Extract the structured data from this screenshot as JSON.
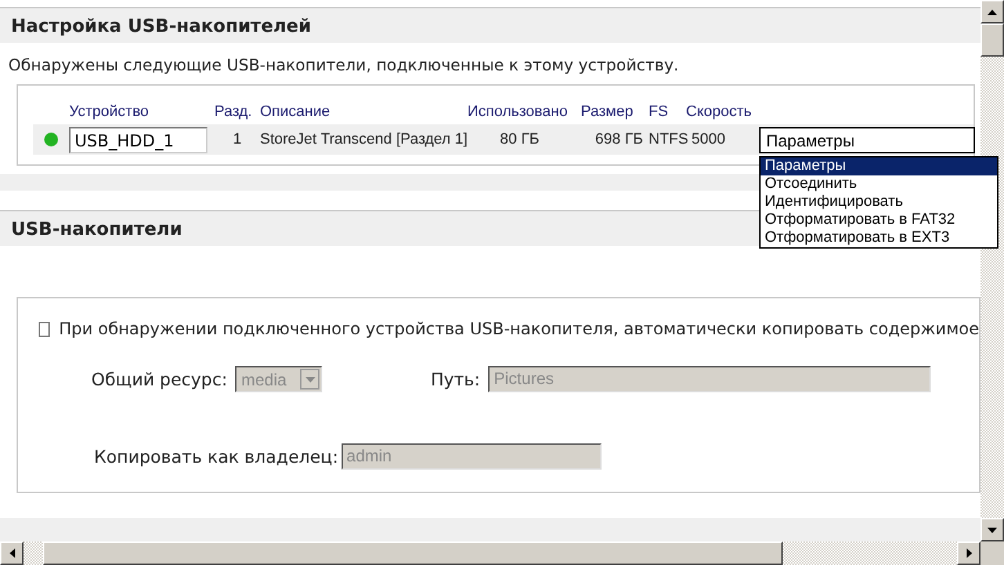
{
  "setup": {
    "title": "Настройка USB-накопителей",
    "description": "Обнаружены следующие USB-накопители, подключенные к этому устройству.",
    "columns": [
      "Устройство",
      "Разд.",
      "Описание",
      "Использовано",
      "Размер",
      "FS",
      "Скорость"
    ],
    "rows": [
      {
        "color": "#22b322",
        "device": "USB_HDD_1",
        "partition": "1",
        "description": "StoreJet Transcend [Раздел 1]",
        "used": "80 ГБ",
        "size": "698 ГБ",
        "fs": "NTFS",
        "speed": "5000",
        "action": "Параметры",
        "expanded": true,
        "options": [
          {
            "label": "Параметры",
            "selected": true
          },
          {
            "label": "Отсоединить",
            "selected": false
          },
          {
            "label": "Идентифицировать",
            "selected": false
          },
          {
            "label": "Отформатировать в FAT32",
            "selected": false
          },
          {
            "label": "Отформатировать в EXT3",
            "selected": false
          }
        ]
      }
    ]
  },
  "usb_drives": {
    "title": "USB-накопители",
    "auto_copy": {
      "label": "При обнаружении подключенного устройства USB-накопителя, автоматически копировать содержимое",
      "checked": false
    },
    "share": {
      "label": "Общий ресурс:",
      "value": "media",
      "disabled": true
    },
    "path": {
      "label": "Путь:",
      "value": "Pictures",
      "disabled": true
    },
    "owner": {
      "label": "Копировать как владелец:",
      "value": "admin",
      "disabled": true
    }
  }
}
